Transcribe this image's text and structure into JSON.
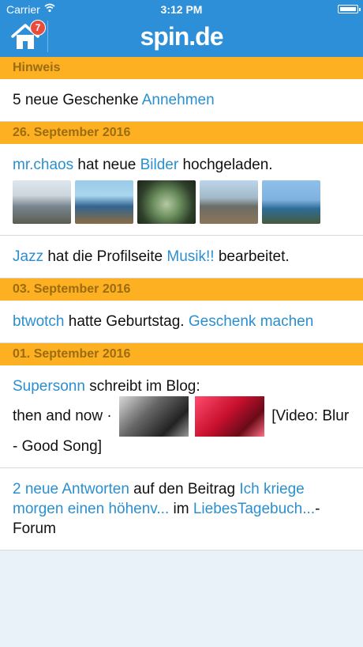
{
  "status": {
    "carrier": "Carrier",
    "time": "3:12 PM"
  },
  "header": {
    "badge_count": "7",
    "logo": "spin.de"
  },
  "sections": {
    "hinweis": "Hinweis",
    "date1": "26. September 2016",
    "date2": "03. September 2016",
    "date3": "01. September 2016"
  },
  "hinweis": {
    "text": "5 neue Geschenke",
    "link": "Annehmen"
  },
  "item1": {
    "user": "mr.chaos",
    "text1": "hat neue",
    "link": "Bilder",
    "text2": "hochgeladen."
  },
  "item2": {
    "user": "Jazz",
    "text1": "hat die Profilseite",
    "link": "Musik!!",
    "text2": "bearbeitet."
  },
  "item3": {
    "user": "btwotch",
    "text1": "hatte Geburtstag.",
    "link": "Geschenk machen"
  },
  "item4": {
    "user": "Supersonn",
    "text1": "schreibt im Blog:",
    "text2": "then and now ·",
    "text3": "[Video: Blur - Good Song]"
  },
  "item5": {
    "link1": "2 neue Antworten",
    "text1": "auf den Beitrag",
    "link2": "Ich kriege morgen einen höhenv...",
    "text2": "im",
    "link3": "LiebesTagebuch...",
    "text3": "-Forum"
  }
}
